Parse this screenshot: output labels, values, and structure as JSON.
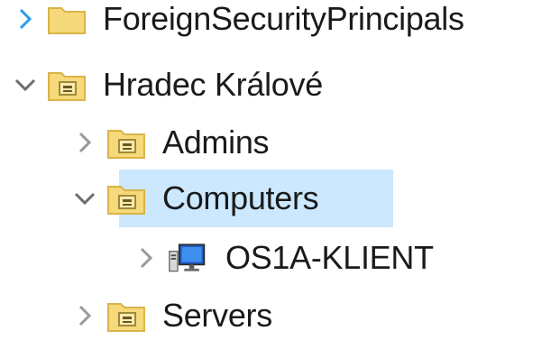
{
  "tree": {
    "items": [
      {
        "label": "ForeignSecurityPrincipals",
        "icon": "folder-icon",
        "expander": "expand-chevron-icon",
        "state": "collapsed",
        "expander_color": "#2b9bf0"
      },
      {
        "label": "Hradec Králové",
        "icon": "organizational-unit-icon",
        "expander": "collapse-chevron-icon",
        "state": "expanded"
      },
      {
        "label": "Admins",
        "icon": "organizational-unit-icon",
        "expander": "expand-chevron-icon",
        "state": "collapsed"
      },
      {
        "label": "Computers",
        "icon": "organizational-unit-icon",
        "expander": "collapse-chevron-icon",
        "state": "expanded",
        "selected": true
      },
      {
        "label": "OS1A-KLIENT",
        "icon": "computer-icon",
        "expander": "expand-chevron-icon",
        "state": "collapsed"
      },
      {
        "label": "Servers",
        "icon": "organizational-unit-icon",
        "expander": "expand-chevron-icon",
        "state": "collapsed"
      }
    ]
  },
  "colors": {
    "selection": "#cce8ff",
    "chevron": "#6d6d6d",
    "chevron_hover": "#2b9bf0",
    "folder": "#f5d97a",
    "folder_dark": "#d9b44a"
  }
}
